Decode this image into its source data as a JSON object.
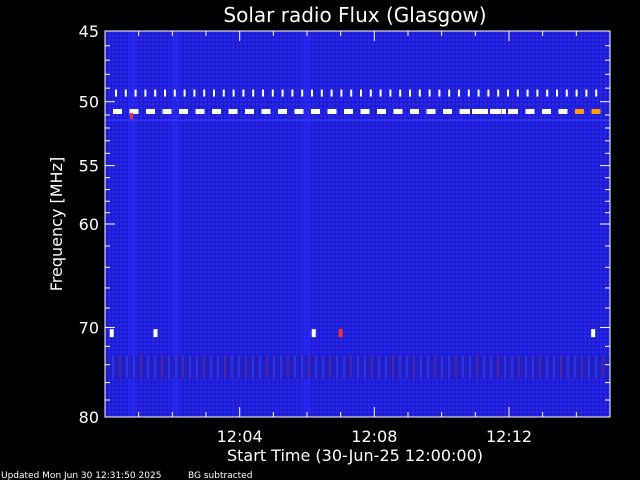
{
  "chart_data": {
    "type": "heatmap",
    "title": "Solar radio Flux (Glasgow)",
    "xlabel": "Start Time (30-Jun-25 12:00:00)",
    "ylabel": "Frequency [MHz]",
    "x_tick_labels": [
      "12:04",
      "12:08",
      "12:12"
    ],
    "x_tick_minutes": [
      4,
      8,
      12
    ],
    "xlim_minutes": [
      0,
      15.0
    ],
    "y_tick_labels": [
      "45",
      "50",
      "55",
      "60",
      "70",
      "80"
    ],
    "y_tick_values": [
      45,
      50,
      55,
      60,
      70,
      80
    ],
    "ylim": [
      45,
      80
    ],
    "y_scale": "log",
    "colormap": {
      "background": "#1a1acc",
      "noise": "#2d2dff",
      "hot": "#ffffff",
      "warm": "#ff9a00",
      "red": "#ff2a2a"
    },
    "features": {
      "dotted_band_freq": 49.4,
      "dashed_band_freq": 50.7,
      "dim_band_freq": 51.4,
      "spot_freq": 70.6,
      "spot_minutes": [
        0.2,
        1.5,
        6.2,
        7.0,
        14.5
      ],
      "interference_freq_range": [
        73.0,
        75.5
      ],
      "vertical_streak_minutes": [
        0.8,
        2.1,
        6.0
      ]
    },
    "footer_left": "Updated Mon Jun 30 12:31:50 2025",
    "footer_right": "BG subtracted"
  }
}
